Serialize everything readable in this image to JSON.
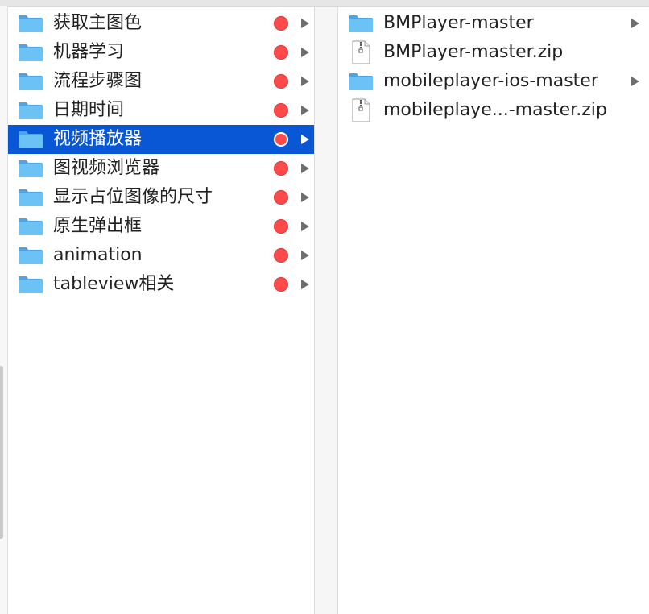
{
  "colors": {
    "selection": "#0a57d6",
    "tag_red": "#fe4a4a",
    "folder_blue": "#5fb8f2",
    "text": "#222222"
  },
  "column1": {
    "items": [
      {
        "label": "获取主图色",
        "icon": "folder-icon",
        "tag": "red",
        "selected": false
      },
      {
        "label": "机器学习",
        "icon": "folder-icon",
        "tag": "red",
        "selected": false
      },
      {
        "label": "流程步骤图",
        "icon": "folder-icon",
        "tag": "red",
        "selected": false
      },
      {
        "label": "日期时间",
        "icon": "folder-icon",
        "tag": "red",
        "selected": false
      },
      {
        "label": "视频播放器",
        "icon": "folder-icon",
        "tag": "red",
        "selected": true
      },
      {
        "label": "图视频浏览器",
        "icon": "folder-icon",
        "tag": "red",
        "selected": false
      },
      {
        "label": "显示占位图像的尺寸",
        "icon": "folder-icon",
        "tag": "red",
        "selected": false
      },
      {
        "label": "原生弹出框",
        "icon": "folder-icon",
        "tag": "red",
        "selected": false
      },
      {
        "label": "animation",
        "icon": "folder-icon",
        "tag": "red",
        "selected": false
      },
      {
        "label": "tableview相关",
        "icon": "folder-icon",
        "tag": "red",
        "selected": false
      }
    ]
  },
  "column2": {
    "items": [
      {
        "label": "BMPlayer-master",
        "icon": "folder-icon"
      },
      {
        "label": "BMPlayer-master.zip",
        "icon": "zip-file-icon"
      },
      {
        "label": "mobileplayer-ios-master",
        "icon": "folder-icon"
      },
      {
        "label": "mobileplaye...-master.zip",
        "icon": "zip-file-icon"
      }
    ]
  }
}
